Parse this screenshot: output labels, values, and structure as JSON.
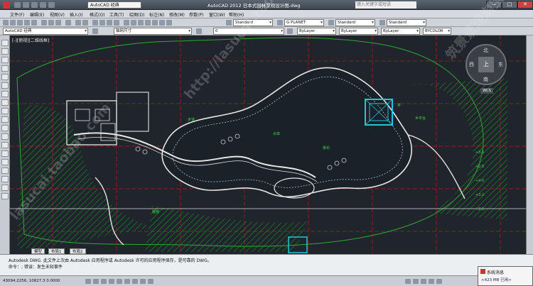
{
  "titlebar": {
    "workspace": "AutoCAD 经典",
    "title": "AutoCAD 2012  日本式园林景观设计图.dwg",
    "search_placeholder": "键入关键字或短语",
    "minimize": "—",
    "maximize": "□",
    "close": "✕"
  },
  "menu": [
    "文件(F)",
    "编辑(E)",
    "视图(V)",
    "插入(I)",
    "格式(O)",
    "工具(T)",
    "绘图(D)",
    "标注(N)",
    "修改(M)",
    "参数(P)",
    "窗口(W)",
    "帮助(H)"
  ],
  "toolbar1": {
    "text_style": "Standard",
    "dim_style": "G PLANET",
    "table_style": "Standard",
    "mleader_style": "Standard"
  },
  "toolbar2": {
    "workspace": "AutoCAD 经典",
    "dim_text": "轴网尺寸",
    "layer": "0",
    "color": "ByLayer",
    "linetype": "ByLayer",
    "lineweight": "ByLayer",
    "plot_style": "BYCOLOR"
  },
  "viewport_label": "[-][俯视][二维线框]",
  "compass": {
    "north": "北",
    "south": "南",
    "west": "西",
    "east": "东",
    "top": "上",
    "wcs": "WCS"
  },
  "layout_tabs": [
    "模型",
    "布局1",
    "布局2"
  ],
  "command_lines": [
    "Autodesk DWG.   此文件上次由 Autodesk 应用程序或 Autodesk 许可的应用程序保存，是可靠的 DWG。",
    "命令：; 错误：发生未知事件"
  ],
  "coordinates": "43094.2256, 10827.3  0.0000",
  "notification": {
    "title": "系统消息",
    "body": "<423 MB 已用>"
  },
  "watermarks": [
    "http://lasucai.taobao.com",
    "筑景景观淘宝站",
    "lasucai.taobao.com"
  ],
  "annotations": [
    "水体",
    "步道",
    "景石",
    "植物",
    "木平台",
    "亭",
    "+3.5",
    "+2.8",
    "+4.0",
    "+3.2",
    "+2.5"
  ],
  "colors": {
    "canvas": "#20252b",
    "outline": "#e6e6e6",
    "hatch": "#1f8f2a",
    "grid": "#b01c1c",
    "accent": "#20c7d8"
  }
}
